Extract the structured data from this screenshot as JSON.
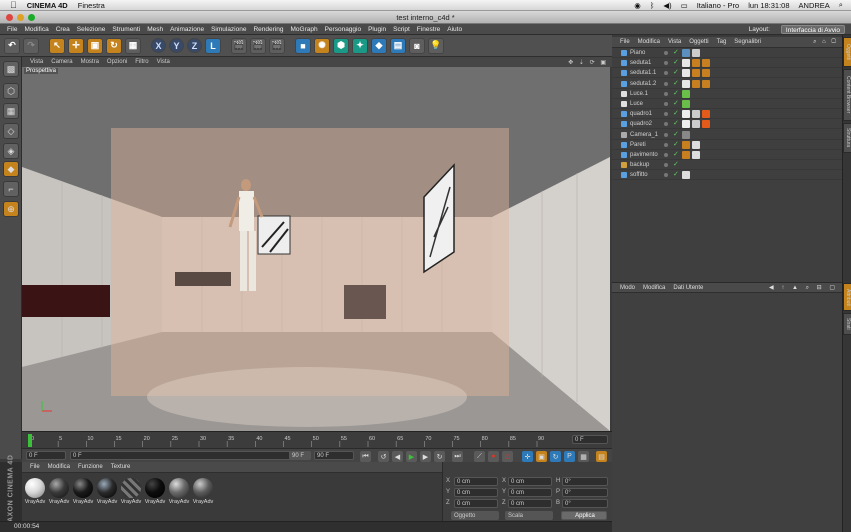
{
  "macbar": {
    "app": "CINEMA 4D",
    "menu": "Finestra",
    "input_source": "Italiano - Pro",
    "clock": "lun 18:31:08",
    "user": "ANDREA"
  },
  "window": {
    "title": "test interno_c4d *"
  },
  "appmenu": {
    "items": [
      "File",
      "Modifica",
      "Crea",
      "Selezione",
      "Strumenti",
      "Mesh",
      "Animazione",
      "Simulazione",
      "Rendering",
      "MoGraph",
      "Personaggio",
      "Plugin",
      "Script",
      "Finestre",
      "Aiuto"
    ],
    "layout_label": "Layout:",
    "layout_value": "Interfaccia di Avvio"
  },
  "toolbar": {
    "axis_x": "X",
    "axis_y": "Y",
    "axis_z": "Z",
    "coord": "L"
  },
  "viewport": {
    "menu": [
      "Vista",
      "Camera",
      "Mostra",
      "Opzioni",
      "Filtro",
      "Vista"
    ],
    "label": "Prospettiva"
  },
  "timeline": {
    "ticks": [
      "0",
      "5",
      "10",
      "15",
      "20",
      "25",
      "30",
      "35",
      "40",
      "45",
      "50",
      "55",
      "60",
      "65",
      "70",
      "75",
      "80",
      "85",
      "90"
    ],
    "current_frame": "0 F"
  },
  "transport": {
    "start": "0 F",
    "min": "0 F",
    "max": "90 F",
    "end": "90 F"
  },
  "materials": {
    "menu": [
      "File",
      "Modifica",
      "Funzione",
      "Texture"
    ],
    "items": [
      {
        "label": "VrayAdv",
        "color": "#d8d8d8"
      },
      {
        "label": "VrayAdv",
        "color": "#3a3a3a"
      },
      {
        "label": "VrayAdv",
        "color": "#1a1a1a"
      },
      {
        "label": "VrayAdv",
        "color": "#2b2b2b"
      },
      {
        "label": "VrayAdv",
        "color": "#555555"
      },
      {
        "label": "VrayAdv",
        "color": "#0c0c0c"
      },
      {
        "label": "VrayAdv",
        "color": "#6a6a6a"
      },
      {
        "label": "VrayAdv",
        "color": "#5c5c5c"
      }
    ]
  },
  "coords": {
    "rows": [
      {
        "a": "X",
        "av": "0 cm",
        "b": "X",
        "bv": "0 cm",
        "c": "H",
        "cv": "0°"
      },
      {
        "a": "Y",
        "av": "0 cm",
        "b": "Y",
        "bv": "0 cm",
        "c": "P",
        "cv": "0°"
      },
      {
        "a": "Z",
        "av": "0 cm",
        "b": "Z",
        "bv": "0 cm",
        "c": "B",
        "cv": "0°"
      }
    ],
    "mode1": "Oggetto",
    "mode2": "Scala",
    "apply": "Applica"
  },
  "status": {
    "time": "00:00:54"
  },
  "maxon": "MAXON CINEMA 4D",
  "objects": {
    "menu": [
      "File",
      "Modifica",
      "Vista",
      "Oggetti",
      "Tag",
      "Segnalibri"
    ],
    "rows": [
      {
        "name": "Piano",
        "icon": "#5aa0e0"
      },
      {
        "name": "seduta1",
        "icon": "#5aa0e0"
      },
      {
        "name": "seduta1.1",
        "icon": "#5aa0e0"
      },
      {
        "name": "seduta1.2",
        "icon": "#5aa0e0"
      },
      {
        "name": "Luce.1",
        "icon": "#e0e0e0"
      },
      {
        "name": "Luce",
        "icon": "#e0e0e0"
      },
      {
        "name": "quadro1",
        "icon": "#5aa0e0"
      },
      {
        "name": "quadro2",
        "icon": "#5aa0e0"
      },
      {
        "name": "Camera_1",
        "icon": "#aaaaaa"
      },
      {
        "name": "Pareti",
        "icon": "#5aa0e0"
      },
      {
        "name": "pavimento",
        "icon": "#5aa0e0"
      },
      {
        "name": "backup",
        "icon": "#d0a040"
      },
      {
        "name": "soffitto",
        "icon": "#5aa0e0"
      }
    ]
  },
  "attributes": {
    "menu": [
      "Modo",
      "Modifica",
      "Dati Utente"
    ]
  },
  "rightstrip": {
    "tabs": [
      "Oggetti",
      "Content Browser",
      "Struttura",
      "Attributi",
      "Strati"
    ]
  },
  "colors": {
    "accent_orange": "#c5831e",
    "play_green": "#3cc03c",
    "record_red": "#d03a2a"
  }
}
